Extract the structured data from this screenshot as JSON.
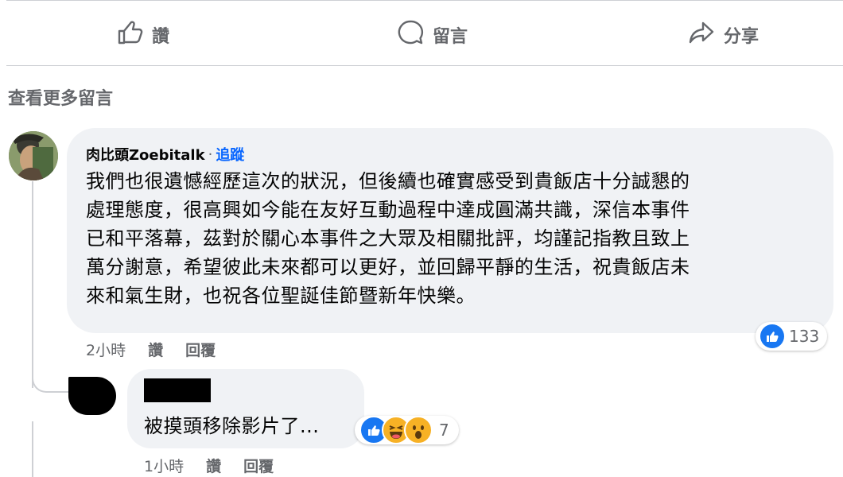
{
  "actions": {
    "like_label": "讚",
    "comment_label": "留言",
    "share_label": "分享"
  },
  "view_more": "查看更多留言",
  "comment1": {
    "author": "肉比頭Zoebitalk",
    "separator": "·",
    "follow_label": "追蹤",
    "text": "我們也很遺憾經歷這次的狀況，但後續也確實感受到貴飯店十分誠懇的\n處理態度，很高興如今能在友好互動過程中達成圓滿共識，深信本事件\n已和平落幕，茲對於關心本事件之大眾及相關批評，均謹記指教且致上\n萬分謝意，希望彼此未來都可以更好，並回歸平靜的生活，祝貴飯店未\n來和氣生財，也祝各位聖誕佳節暨新年快樂。",
    "reaction_count": "133",
    "reaction_icons": [
      "like-icon"
    ],
    "time": "2小時",
    "like_label": "讚",
    "reply_label": "回覆"
  },
  "comment2": {
    "text": "被摸頭移除影片了...",
    "reaction_count": "7",
    "reaction_icons": [
      "like-icon",
      "haha-icon",
      "wow-icon"
    ],
    "time": "1小時",
    "like_label": "讚",
    "reply_label": "回覆"
  },
  "colors": {
    "bubble": "#f0f2f5",
    "secondary_text": "#65676b",
    "link": "#0866ff",
    "like_blue": "#1877f2",
    "divider": "#ced0d4"
  }
}
